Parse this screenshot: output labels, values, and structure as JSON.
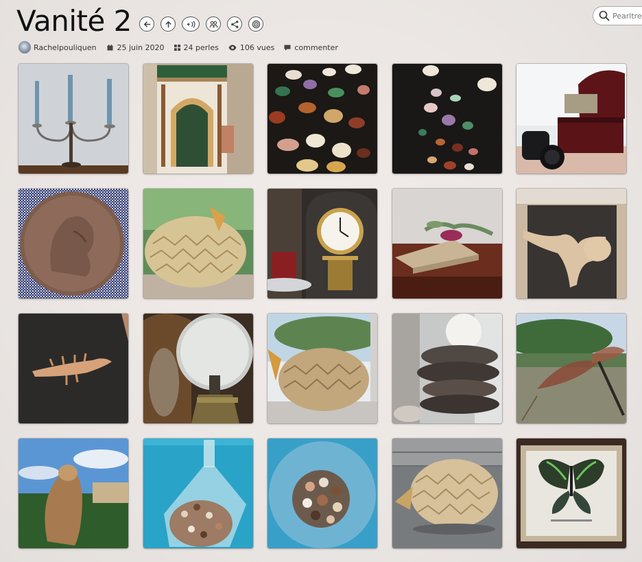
{
  "header": {
    "title": "Vanité 2"
  },
  "actions": [
    {
      "name": "back-button",
      "icon": "arrow-left-icon"
    },
    {
      "name": "up-button",
      "icon": "arrow-up-icon"
    },
    {
      "name": "add-button",
      "icon": "add-plus-icon"
    },
    {
      "name": "members-button",
      "icon": "group-icon"
    },
    {
      "name": "share-button",
      "icon": "share-icon"
    },
    {
      "name": "target-button",
      "icon": "target-icon"
    }
  ],
  "search": {
    "placeholder": "Pearltrees"
  },
  "meta": {
    "author": "Rachelpouliquen",
    "date": "25 juin 2020",
    "pearls": "24 perles",
    "views": "106 vues",
    "comment": "commenter"
  },
  "tiles": [
    {
      "name": "tile-candelabra"
    },
    {
      "name": "tile-doorway-model"
    },
    {
      "name": "tile-gemstones"
    },
    {
      "name": "tile-gemstones-dark"
    },
    {
      "name": "tile-chest-binoculars"
    },
    {
      "name": "tile-old-coin"
    },
    {
      "name": "tile-pufferfish-wood"
    },
    {
      "name": "tile-anniversary-clock"
    },
    {
      "name": "tile-book-flowers"
    },
    {
      "name": "tile-vertebra"
    },
    {
      "name": "tile-bone-fragment"
    },
    {
      "name": "tile-oil-lamp"
    },
    {
      "name": "tile-pufferfish-window"
    },
    {
      "name": "tile-stacked-stones"
    },
    {
      "name": "tile-dragonfly"
    },
    {
      "name": "tile-stuffed-owl"
    },
    {
      "name": "tile-shell-bottle"
    },
    {
      "name": "tile-shell-jar"
    },
    {
      "name": "tile-pufferfish-table"
    },
    {
      "name": "tile-framed-butterfly"
    }
  ]
}
